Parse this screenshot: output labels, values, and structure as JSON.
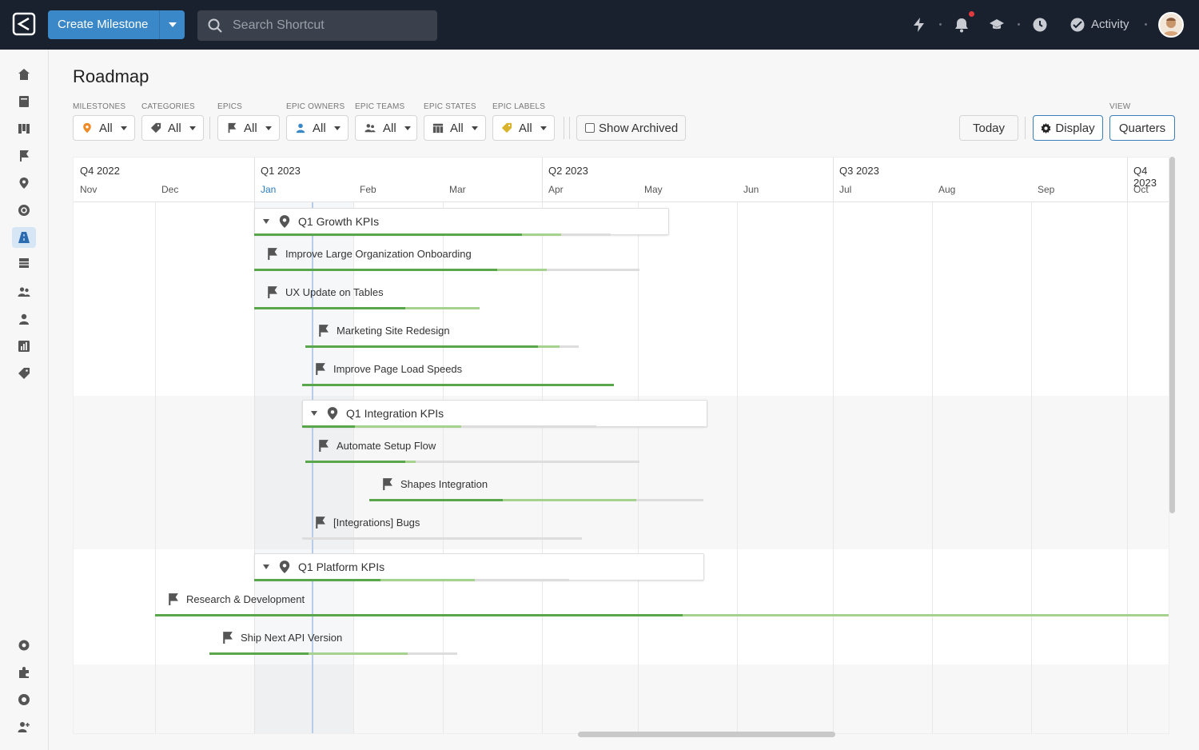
{
  "topbar": {
    "create_label": "Create Milestone",
    "search_placeholder": "Search Shortcut",
    "activity_label": "Activity"
  },
  "page": {
    "title": "Roadmap"
  },
  "filters": [
    {
      "label": "MILESTONES",
      "value": "All",
      "icon": "milestone-icon"
    },
    {
      "label": "CATEGORIES",
      "value": "All",
      "icon": "tag-icon"
    },
    {
      "label": "EPICS",
      "value": "All",
      "icon": "flag-icon"
    },
    {
      "label": "EPIC OWNERS",
      "value": "All",
      "icon": "user-icon"
    },
    {
      "label": "EPIC TEAMS",
      "value": "All",
      "icon": "team-icon"
    },
    {
      "label": "EPIC STATES",
      "value": "All",
      "icon": "states-icon"
    },
    {
      "label": "EPIC LABELS",
      "value": "All",
      "icon": "label-icon"
    }
  ],
  "show_archived_label": "Show Archived",
  "today_label": "Today",
  "display_label": "Display",
  "view": {
    "label": "VIEW",
    "value": "Quarters"
  },
  "timeline": {
    "quarters": [
      "Q4 2022",
      "Q1 2023",
      "Q2 2023",
      "Q3 2023",
      "Q4 2023"
    ],
    "months": [
      "Nov",
      "Dec",
      "Jan",
      "Feb",
      "Mar",
      "Apr",
      "May",
      "Jun",
      "Jul",
      "Aug",
      "Sep",
      "Oct"
    ],
    "current_month": "Jan",
    "milestones": [
      {
        "name": "Q1 Growth KPIs",
        "progress_done": 0.75,
        "progress_started": 0.86,
        "epics": [
          {
            "name": "Improve Large Organization Onboarding",
            "progress_done": 0.63,
            "progress_started": 0.76
          },
          {
            "name": "UX Update on Tables",
            "progress_done": 0.67,
            "progress_started": 1.0
          },
          {
            "name": "Marketing Site Redesign",
            "progress_done": 0.85,
            "progress_started": 0.93
          },
          {
            "name": "Improve Page Load Speeds",
            "progress_done": 1.0,
            "progress_started": 1.0
          }
        ]
      },
      {
        "name": "Q1 Integration KPIs",
        "progress_done": 0.18,
        "progress_started": 0.54,
        "epics": [
          {
            "name": "Automate Setup Flow",
            "progress_done": 0.3,
            "progress_started": 0.33
          },
          {
            "name": "Shapes Integration",
            "progress_done": 0.4,
            "progress_started": 0.8
          },
          {
            "name": "[Integrations] Bugs",
            "progress_done": 0.0,
            "progress_started": 0.0
          }
        ]
      },
      {
        "name": "Q1 Platform KPIs",
        "progress_done": 0.4,
        "progress_started": 0.7,
        "epics": [
          {
            "name": "Research & Development",
            "progress_done": 0.52,
            "progress_started": 1.0
          },
          {
            "name": "Ship Next API Version",
            "progress_done": 0.4,
            "progress_started": 0.8
          }
        ]
      }
    ]
  },
  "colors": {
    "topbar": "#19202e",
    "primary": "#3a88c8",
    "progress_done": "#5aa64a",
    "progress_started": "#a5d38f",
    "today_line": "#b7cce8"
  }
}
